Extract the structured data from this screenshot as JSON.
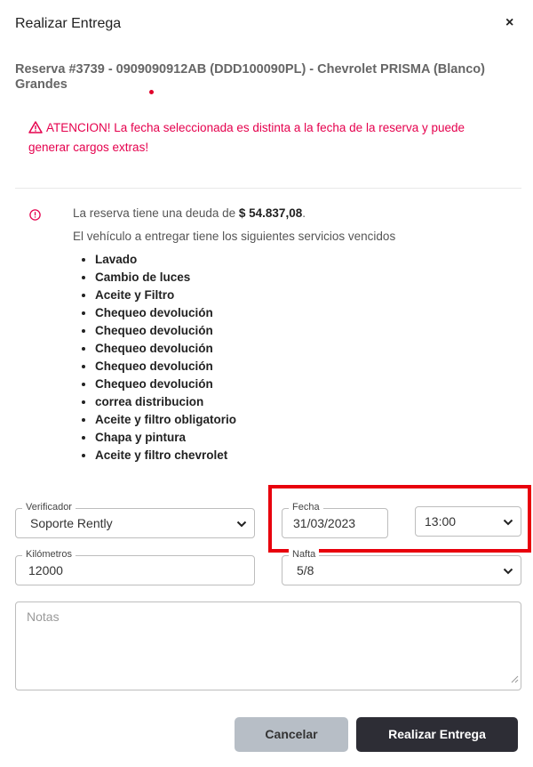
{
  "modal": {
    "title": "Realizar Entrega",
    "close_label": "×",
    "reservation": "Reserva #3739 - 0909090912AB (DDD100090PL) - Chevrolet PRISMA (Blanco) Grandes"
  },
  "warning": {
    "icon": "warning-triangle-icon",
    "text": "ATENCION! La fecha seleccionada es distinta a la fecha de la reserva y puede generar cargos extras!",
    "color": "#e5004d"
  },
  "info": {
    "icon": "info-circle-icon",
    "debt_prefix": "La reserva tiene una deuda de ",
    "debt_amount": "$ 54.837,08",
    "debt_suffix": ".",
    "services_title": "El vehículo a entregar tiene los siguientes servicios vencidos",
    "services": [
      "Lavado",
      "Cambio de luces",
      "Aceite y Filtro",
      "Chequeo devolución",
      "Chequeo devolución",
      "Chequeo devolución",
      "Chequeo devolución",
      "Chequeo devolución",
      "correa distribucion",
      "Aceite y filtro obligatorio",
      "Chapa y pintura",
      "Aceite y filtro chevrolet"
    ]
  },
  "form": {
    "verificador": {
      "label": "Verificador",
      "value": "Soporte Rently"
    },
    "fecha": {
      "label": "Fecha",
      "value": "31/03/2023"
    },
    "hora": {
      "value": "13:00"
    },
    "kilometros": {
      "label": "Kilómetros",
      "value": "12000"
    },
    "nafta": {
      "label": "Nafta",
      "value": "5/8"
    },
    "notas": {
      "placeholder": "Notas"
    }
  },
  "buttons": {
    "cancel": "Cancelar",
    "submit": "Realizar Entrega"
  },
  "colors": {
    "highlight": "#e8000c",
    "submit_bg": "#2d2d35",
    "cancel_bg": "#b7bec6"
  }
}
